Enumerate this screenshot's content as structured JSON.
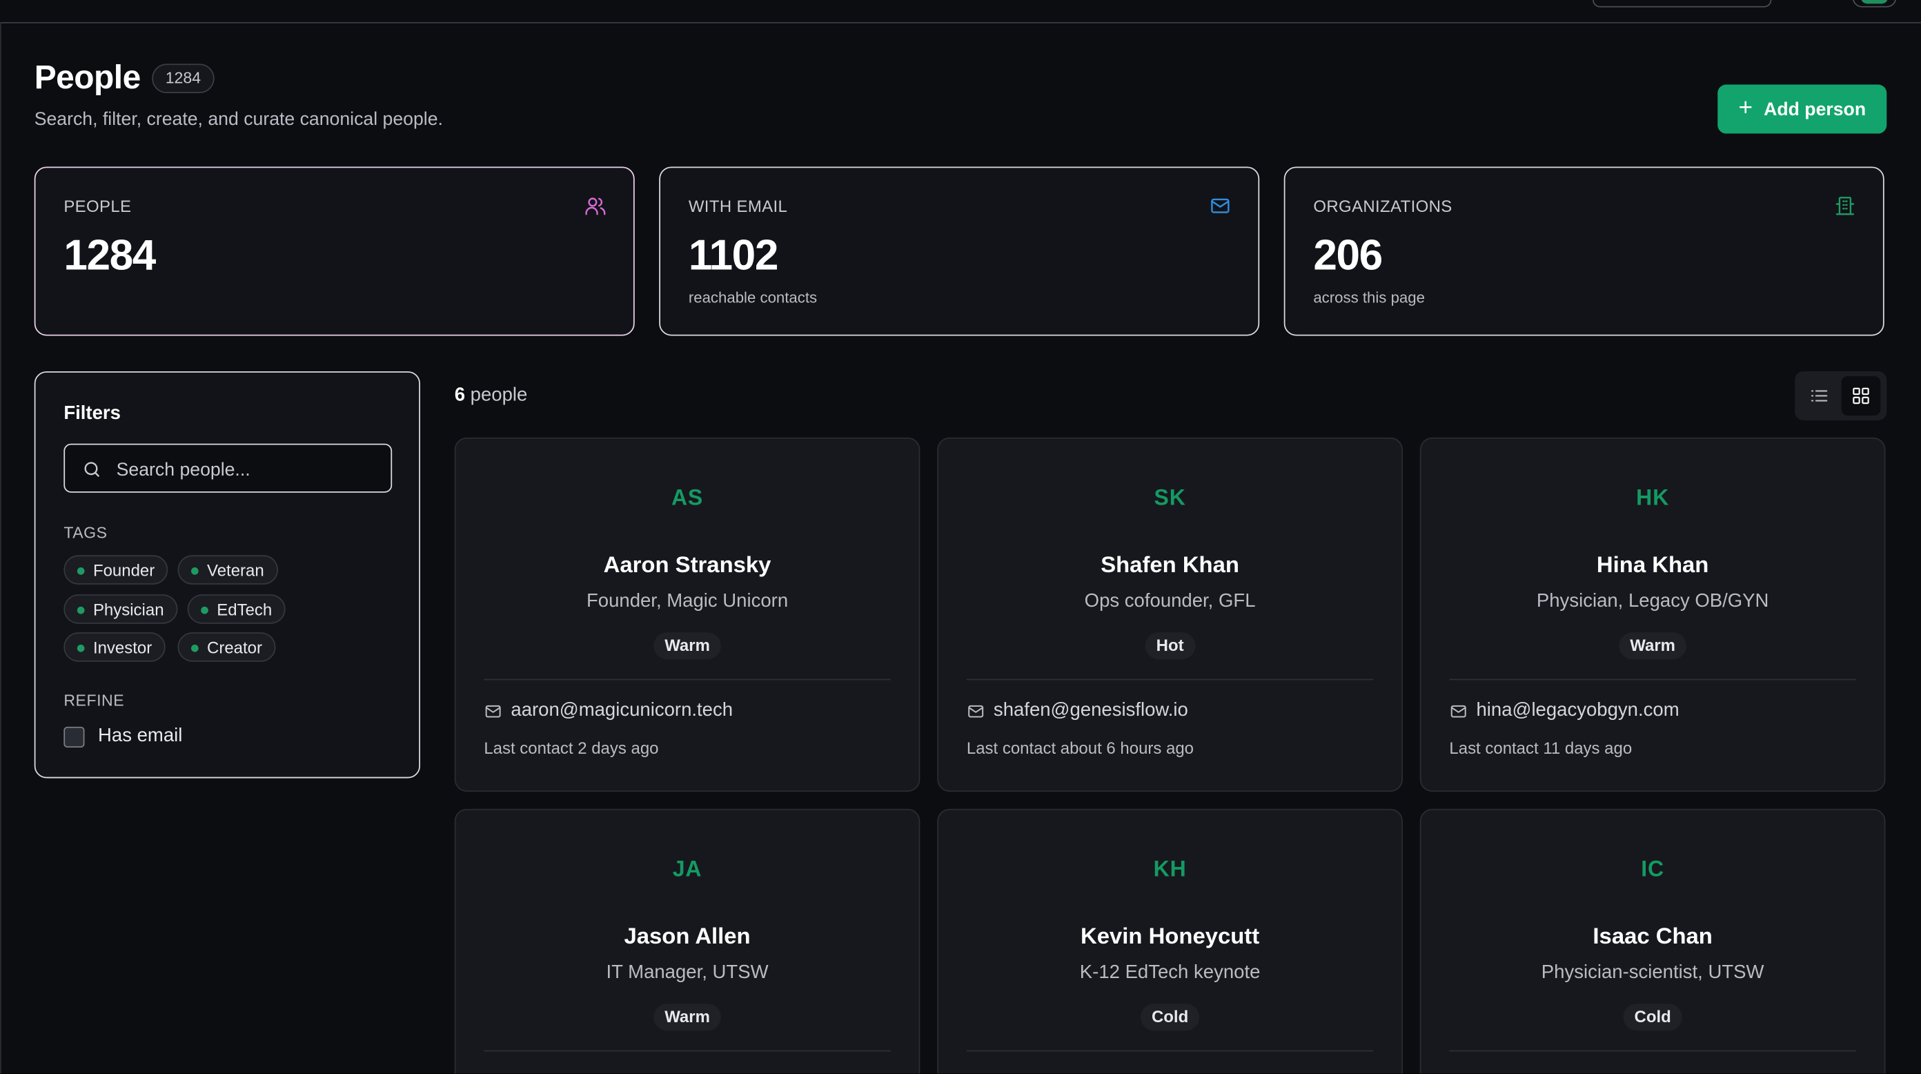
{
  "header": {
    "title": "People",
    "count_badge": "1284",
    "subtitle": "Search, filter, create, and curate canonical people.",
    "add_button": "Add person"
  },
  "stats": [
    {
      "label": "PEOPLE",
      "value": "1284",
      "sub": "",
      "icon": "users-icon",
      "color": "#d96bd6"
    },
    {
      "label": "WITH EMAIL",
      "value": "1102",
      "sub": "reachable contacts",
      "icon": "mail-icon",
      "color": "#2f8fe0"
    },
    {
      "label": "ORGANIZATIONS",
      "value": "206",
      "sub": "across this page",
      "icon": "building-icon",
      "color": "#1f9a63"
    }
  ],
  "filters": {
    "title": "Filters",
    "search_placeholder": "Search people...",
    "tags_label": "TAGS",
    "tags": [
      "Founder",
      "Veteran",
      "Physician",
      "EdTech",
      "Investor",
      "Creator"
    ],
    "refine_label": "REFINE",
    "has_email_label": "Has email",
    "has_email_checked": false
  },
  "results": {
    "count": "6",
    "count_label": "people",
    "view_mode": "grid"
  },
  "people": [
    {
      "initials": "AS",
      "name": "Aaron Stransky",
      "role": "Founder, Magic Unicorn",
      "status": "Warm",
      "email": "aaron@magicunicorn.tech",
      "last_contact": "Last contact 2 days ago"
    },
    {
      "initials": "SK",
      "name": "Shafen Khan",
      "role": "Ops cofounder, GFL",
      "status": "Hot",
      "email": "shafen@genesisflow.io",
      "last_contact": "Last contact about 6 hours ago"
    },
    {
      "initials": "HK",
      "name": "Hina Khan",
      "role": "Physician, Legacy OB/GYN",
      "status": "Warm",
      "email": "hina@legacyobgyn.com",
      "last_contact": "Last contact 11 days ago"
    },
    {
      "initials": "JA",
      "name": "Jason Allen",
      "role": "IT Manager, UTSW",
      "status": "Warm"
    },
    {
      "initials": "KH",
      "name": "Kevin Honeycutt",
      "role": "K-12 EdTech keynote",
      "status": "Cold"
    },
    {
      "initials": "IC",
      "name": "Isaac Chan",
      "role": "Physician-scientist, UTSW",
      "status": "Cold"
    }
  ],
  "colors": {
    "accent": "#12a46c",
    "background": "#0c0d11",
    "card": "#17181d"
  }
}
